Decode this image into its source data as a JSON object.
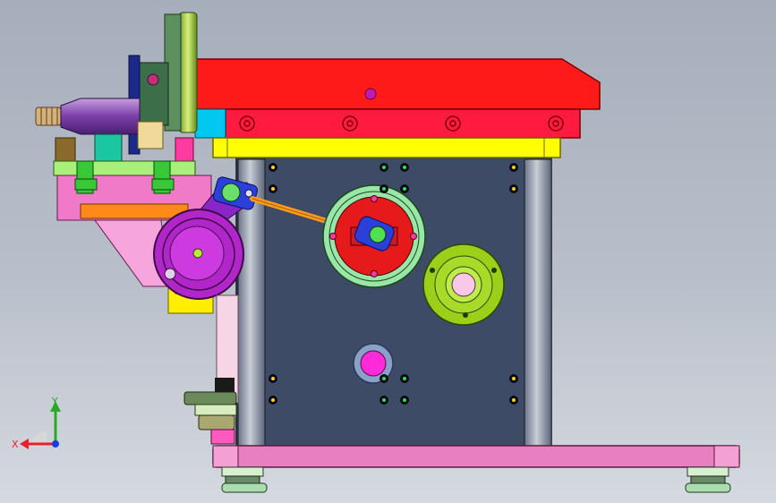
{
  "triad": {
    "x_label": "X",
    "y_label": "Y",
    "x_color": "#e8202a",
    "y_color": "#2aa82a",
    "z_color": "#1a3fd8"
  },
  "palette": {
    "background_top": "#a7aebb",
    "background_bottom": "#d5d9e0",
    "main_plate": "#3d4b66",
    "top_block": "#ff1a1a",
    "yellow_plate": "#ffff00",
    "pink_base": "#e87fc0",
    "green_disk": "#99e6a8",
    "lime_flange": "#9ccf1a",
    "purple_pulley": "#b026c8",
    "magenta_hub": "#ff2ad8"
  },
  "icons": [
    "axis-triad-icon"
  ]
}
